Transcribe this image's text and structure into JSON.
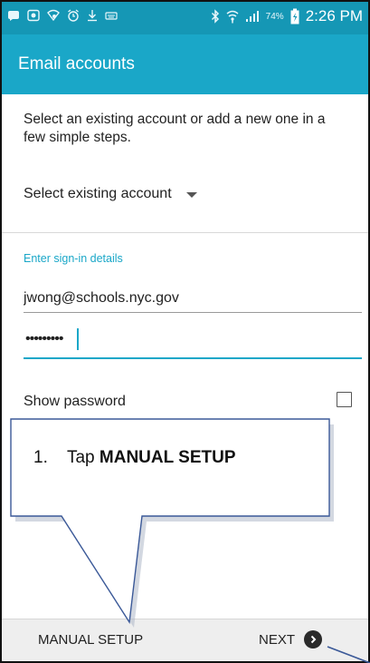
{
  "status_bar": {
    "battery_percent": "74%",
    "time": "2:26 PM",
    "icons_left": [
      "messenger-icon",
      "screen-record-icon",
      "signal-sync-icon",
      "alarm-icon",
      "download-icon",
      "keyboard-icon"
    ],
    "icons_right": [
      "bluetooth-icon",
      "wifi-icon",
      "cell-signal-icon",
      "battery-charging-icon"
    ]
  },
  "app_bar": {
    "title": "Email accounts"
  },
  "form": {
    "intro": "Select an existing account or add a new one in a few simple steps.",
    "select_existing": "Select existing account",
    "section_label": "Enter sign-in details",
    "email_value": "jwong@schools.nyc.gov",
    "password_mask": "•••••••••",
    "show_password_label": "Show password",
    "show_password_checked": false
  },
  "bottom_bar": {
    "manual_setup": "MANUAL SETUP",
    "next": "NEXT"
  },
  "callout": {
    "number": "1.",
    "prefix": "Tap ",
    "bold": "MANUAL SETUP"
  },
  "colors": {
    "status_bar": "#1597b5",
    "app_bar": "#1aa7c8",
    "accent": "#1aa7c8",
    "bottom_bar": "#eeeeee",
    "callout_fill": "#ffffff",
    "callout_stroke": "#3b5998"
  }
}
